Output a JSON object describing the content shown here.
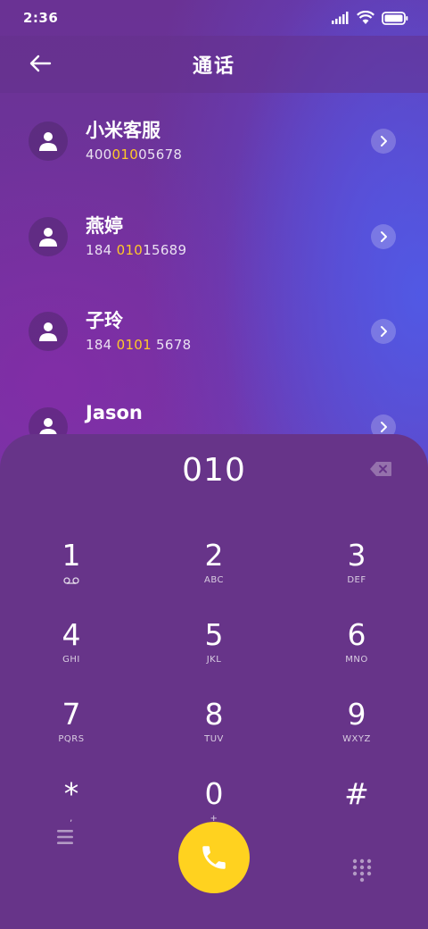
{
  "status_bar": {
    "time": "2:36"
  },
  "header": {
    "title": "通话"
  },
  "contacts": [
    {
      "name": "小米客服",
      "number_pre": "400",
      "number_hl": "010",
      "number_post": "05678"
    },
    {
      "name": "燕婷",
      "number_pre": "184 ",
      "number_hl": "010",
      "number_post": "15689"
    },
    {
      "name": "子玲",
      "number_pre": "184 ",
      "number_hl": "0101",
      "number_post": " 5678"
    },
    {
      "name": "Jason",
      "number_pre": "",
      "number_hl": "",
      "number_post": ""
    }
  ],
  "dialer": {
    "input": "010",
    "keys": [
      {
        "digit": "1",
        "letters": ""
      },
      {
        "digit": "2",
        "letters": "ABC"
      },
      {
        "digit": "3",
        "letters": "DEF"
      },
      {
        "digit": "4",
        "letters": "GHI"
      },
      {
        "digit": "5",
        "letters": "JKL"
      },
      {
        "digit": "6",
        "letters": "MNO"
      },
      {
        "digit": "7",
        "letters": "PQRS"
      },
      {
        "digit": "8",
        "letters": "TUV"
      },
      {
        "digit": "9",
        "letters": "WXYZ"
      },
      {
        "digit": "*",
        "letters": ","
      },
      {
        "digit": "0",
        "letters": "+"
      },
      {
        "digit": "#",
        "letters": ""
      }
    ]
  },
  "icons": {
    "back": "arrow-left-icon",
    "avatar": "person-icon",
    "chevron": "chevron-right-icon",
    "backspace": "backspace-icon",
    "voicemail": "voicemail-icon",
    "menu": "menu-icon",
    "call": "phone-icon",
    "keypad": "dialpad-icon"
  },
  "colors": {
    "accent": "#ffc928",
    "call_button": "#ffd21f",
    "dialpad_bg": "#673489"
  }
}
